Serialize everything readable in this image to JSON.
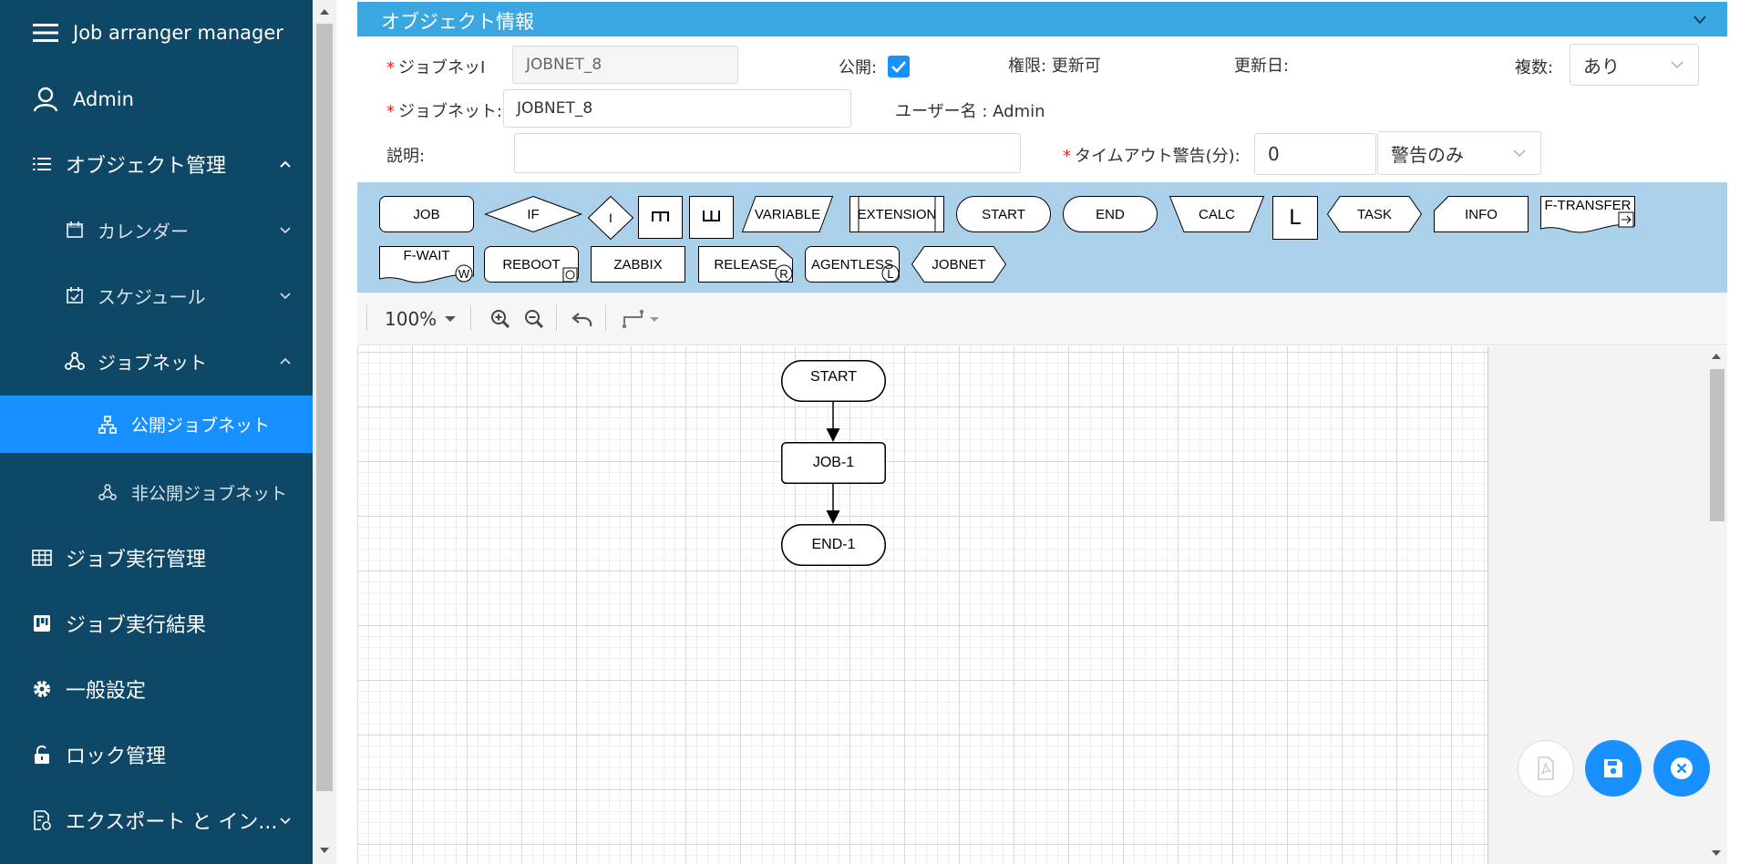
{
  "app": {
    "title": "Job arranger manager"
  },
  "sidebar": {
    "user": "Admin",
    "object_management": "オブジェクト管理",
    "calendar": "カレンダー",
    "schedule": "スケジュール",
    "jobnet": "ジョブネット",
    "public_jobnet": "公開ジョブネット",
    "private_jobnet": "非公開ジョブネット",
    "job_exec_management": "ジョブ実行管理",
    "job_exec_result": "ジョブ実行結果",
    "general_settings": "一般設定",
    "lock_management": "ロック管理",
    "export_import": "エクスポート と イン..."
  },
  "panel": {
    "title": "オブジェクト情報",
    "form": {
      "jobnet_id_label": "ジョブネッI",
      "jobnet_id_value": "JOBNET_8",
      "public_label": "公開:",
      "permission": "権限: 更新可",
      "updated_label": "更新日:",
      "multiple_label": "複数:",
      "multiple_value": "あり",
      "jobnet_name_label": "ジョブネット:",
      "jobnet_name_value": "JOBNET_8",
      "user_label": "ユーザー名 : Admin",
      "description_label": "説明:",
      "description_value": "",
      "timeout_label": "タイムアウト警告(分):",
      "timeout_value": "0",
      "timeout_mode": "警告のみ"
    },
    "palette": {
      "job": "JOB",
      "if": "IF",
      "variable": "VARIABLE",
      "extension": "EXTENSION",
      "start": "START",
      "end": "END",
      "calc": "CALC",
      "loop": "L",
      "task": "TASK",
      "info": "INFO",
      "ftransfer": "F-TRANSFER",
      "fwait": "F-WAIT",
      "reboot": "REBOOT",
      "zabbix": "ZABBIX",
      "release": "RELEASE",
      "agentless": "AGENTLESS",
      "jobnet": "JOBNET",
      "parallel_start": "M",
      "parallel_end": "W",
      "join": "I"
    },
    "toolbar": {
      "zoom": "100%"
    },
    "flow": {
      "start": "START",
      "job": "JOB-1",
      "end": "END-1"
    }
  }
}
